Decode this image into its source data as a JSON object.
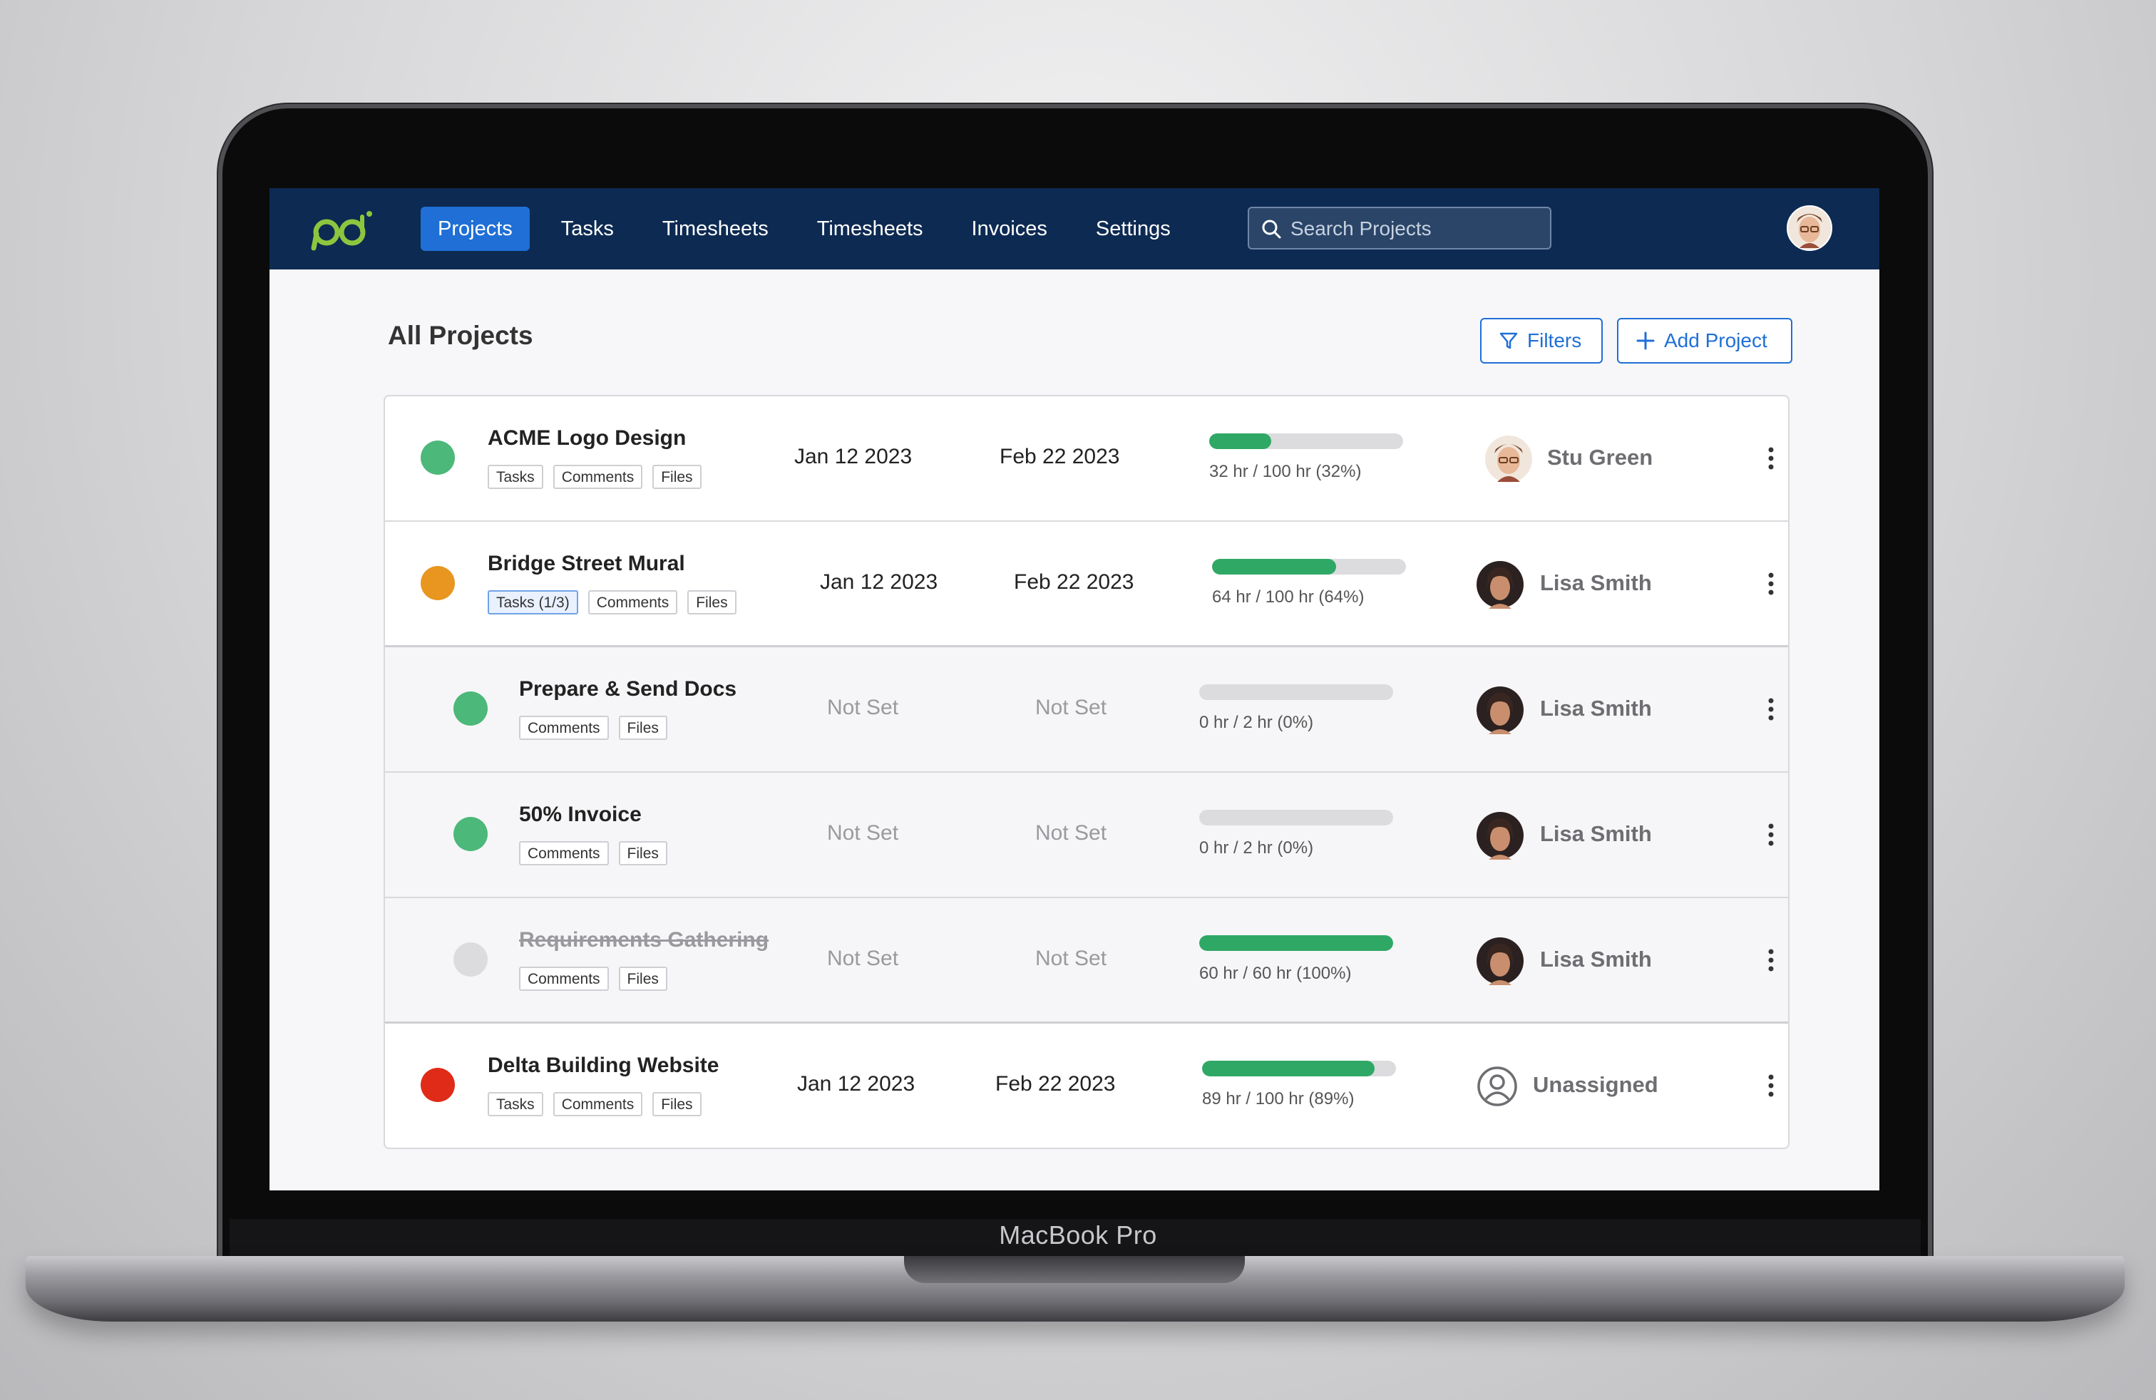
{
  "device": {
    "label": "MacBook Pro"
  },
  "nav": {
    "items": [
      "Projects",
      "Tasks",
      "Timesheets",
      "Timesheets",
      "Invoices",
      "Settings"
    ],
    "active": "Projects"
  },
  "search": {
    "placeholder": "Search Projects",
    "value": ""
  },
  "header": {
    "title": "All Projects",
    "filters_label": "Filters",
    "add_label": "Add Project"
  },
  "colors": {
    "nav_bg": "#0d2a52",
    "accent": "#1f6fd6",
    "progress": "#2fa866",
    "status_green": "#4cb87a",
    "status_orange": "#e8961f",
    "status_red": "#e02b18",
    "status_gray": "#dcdcde"
  },
  "projects": [
    {
      "name": "ACME Logo Design",
      "status": "green",
      "tags": [
        "Tasks",
        "Comments",
        "Files"
      ],
      "start": "Jan 12 2023",
      "end": "Feb 22 2023",
      "progress": 0.32,
      "progress_text": "32 hr / 100 hr (32%)",
      "assignee": "Stu Green",
      "avatar": "man-avatar"
    },
    {
      "name": "Bridge Street Mural",
      "status": "orange",
      "tags": [
        "Tasks (1/3)",
        "Comments",
        "Files"
      ],
      "start": "Jan 12 2023",
      "end": "Feb 22 2023",
      "progress": 0.64,
      "progress_text": "64 hr / 100 hr (64%)",
      "assignee": "Lisa Smith",
      "avatar": "woman-avatar"
    },
    {
      "name": "Prepare & Send Docs",
      "status": "green",
      "tags": [
        "Comments",
        "Files"
      ],
      "start": "Not Set",
      "end": "Not Set",
      "progress": 0,
      "progress_text": "0 hr / 2 hr (0%)",
      "assignee": "Lisa Smith",
      "avatar": "woman-avatar"
    },
    {
      "name": "50% Invoice",
      "status": "green",
      "tags": [
        "Comments",
        "Files"
      ],
      "start": "Not Set",
      "end": "Not Set",
      "progress": 0,
      "progress_text": "0 hr / 2 hr (0%)",
      "assignee": "Lisa Smith",
      "avatar": "woman-avatar"
    },
    {
      "name": "Requirements Gathering",
      "status": "gray",
      "tags": [
        "Comments",
        "Files"
      ],
      "start": "Not Set",
      "end": "Not Set",
      "progress": 1.0,
      "progress_text": "60 hr / 60 hr (100%)",
      "assignee": "Lisa Smith",
      "avatar": "woman-avatar"
    },
    {
      "name": "Delta Building Website",
      "status": "red",
      "tags": [
        "Tasks",
        "Comments",
        "Files"
      ],
      "start": "Jan 12 2023",
      "end": "Feb 22 2023",
      "progress": 0.89,
      "progress_text": "89 hr / 100 hr (89%)",
      "assignee": "Unassigned",
      "avatar": "user-outline-icon"
    }
  ]
}
